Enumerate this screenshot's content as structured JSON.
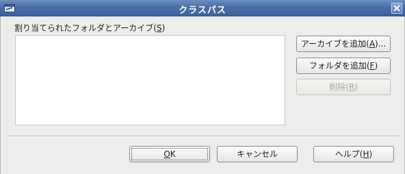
{
  "window": {
    "title": "クラスパス",
    "menu_icon": "window-menu-icon",
    "close_icon": "close-icon"
  },
  "dialog": {
    "list_label": "割り当てられたフォルダとアーカイブ(S)",
    "list_label_prefix": "割り当てられたフォルダとアーカイブ(",
    "list_label_mnemonic": "S",
    "list_label_suffix": ")",
    "items": []
  },
  "buttons": {
    "add_archive": {
      "prefix": "アーカイブを追加(",
      "mnemonic": "A",
      "suffix": ")..."
    },
    "add_folder": {
      "prefix": "フォルダを追加(",
      "mnemonic": "F",
      "suffix": ")"
    },
    "remove": {
      "prefix": "削除(",
      "mnemonic": "R",
      "suffix": ")",
      "enabled": false
    },
    "ok": {
      "mnemonic": "O",
      "suffix": "K"
    },
    "cancel": {
      "label": "キャンセル"
    },
    "help": {
      "prefix": "ヘルプ(",
      "mnemonic": "H",
      "suffix": ")"
    }
  },
  "colors": {
    "titlebar": "#4a6fa8",
    "dialog_bg": "#ededec",
    "list_bg": "#ffffff",
    "disabled_text": "#a7a7a4"
  }
}
